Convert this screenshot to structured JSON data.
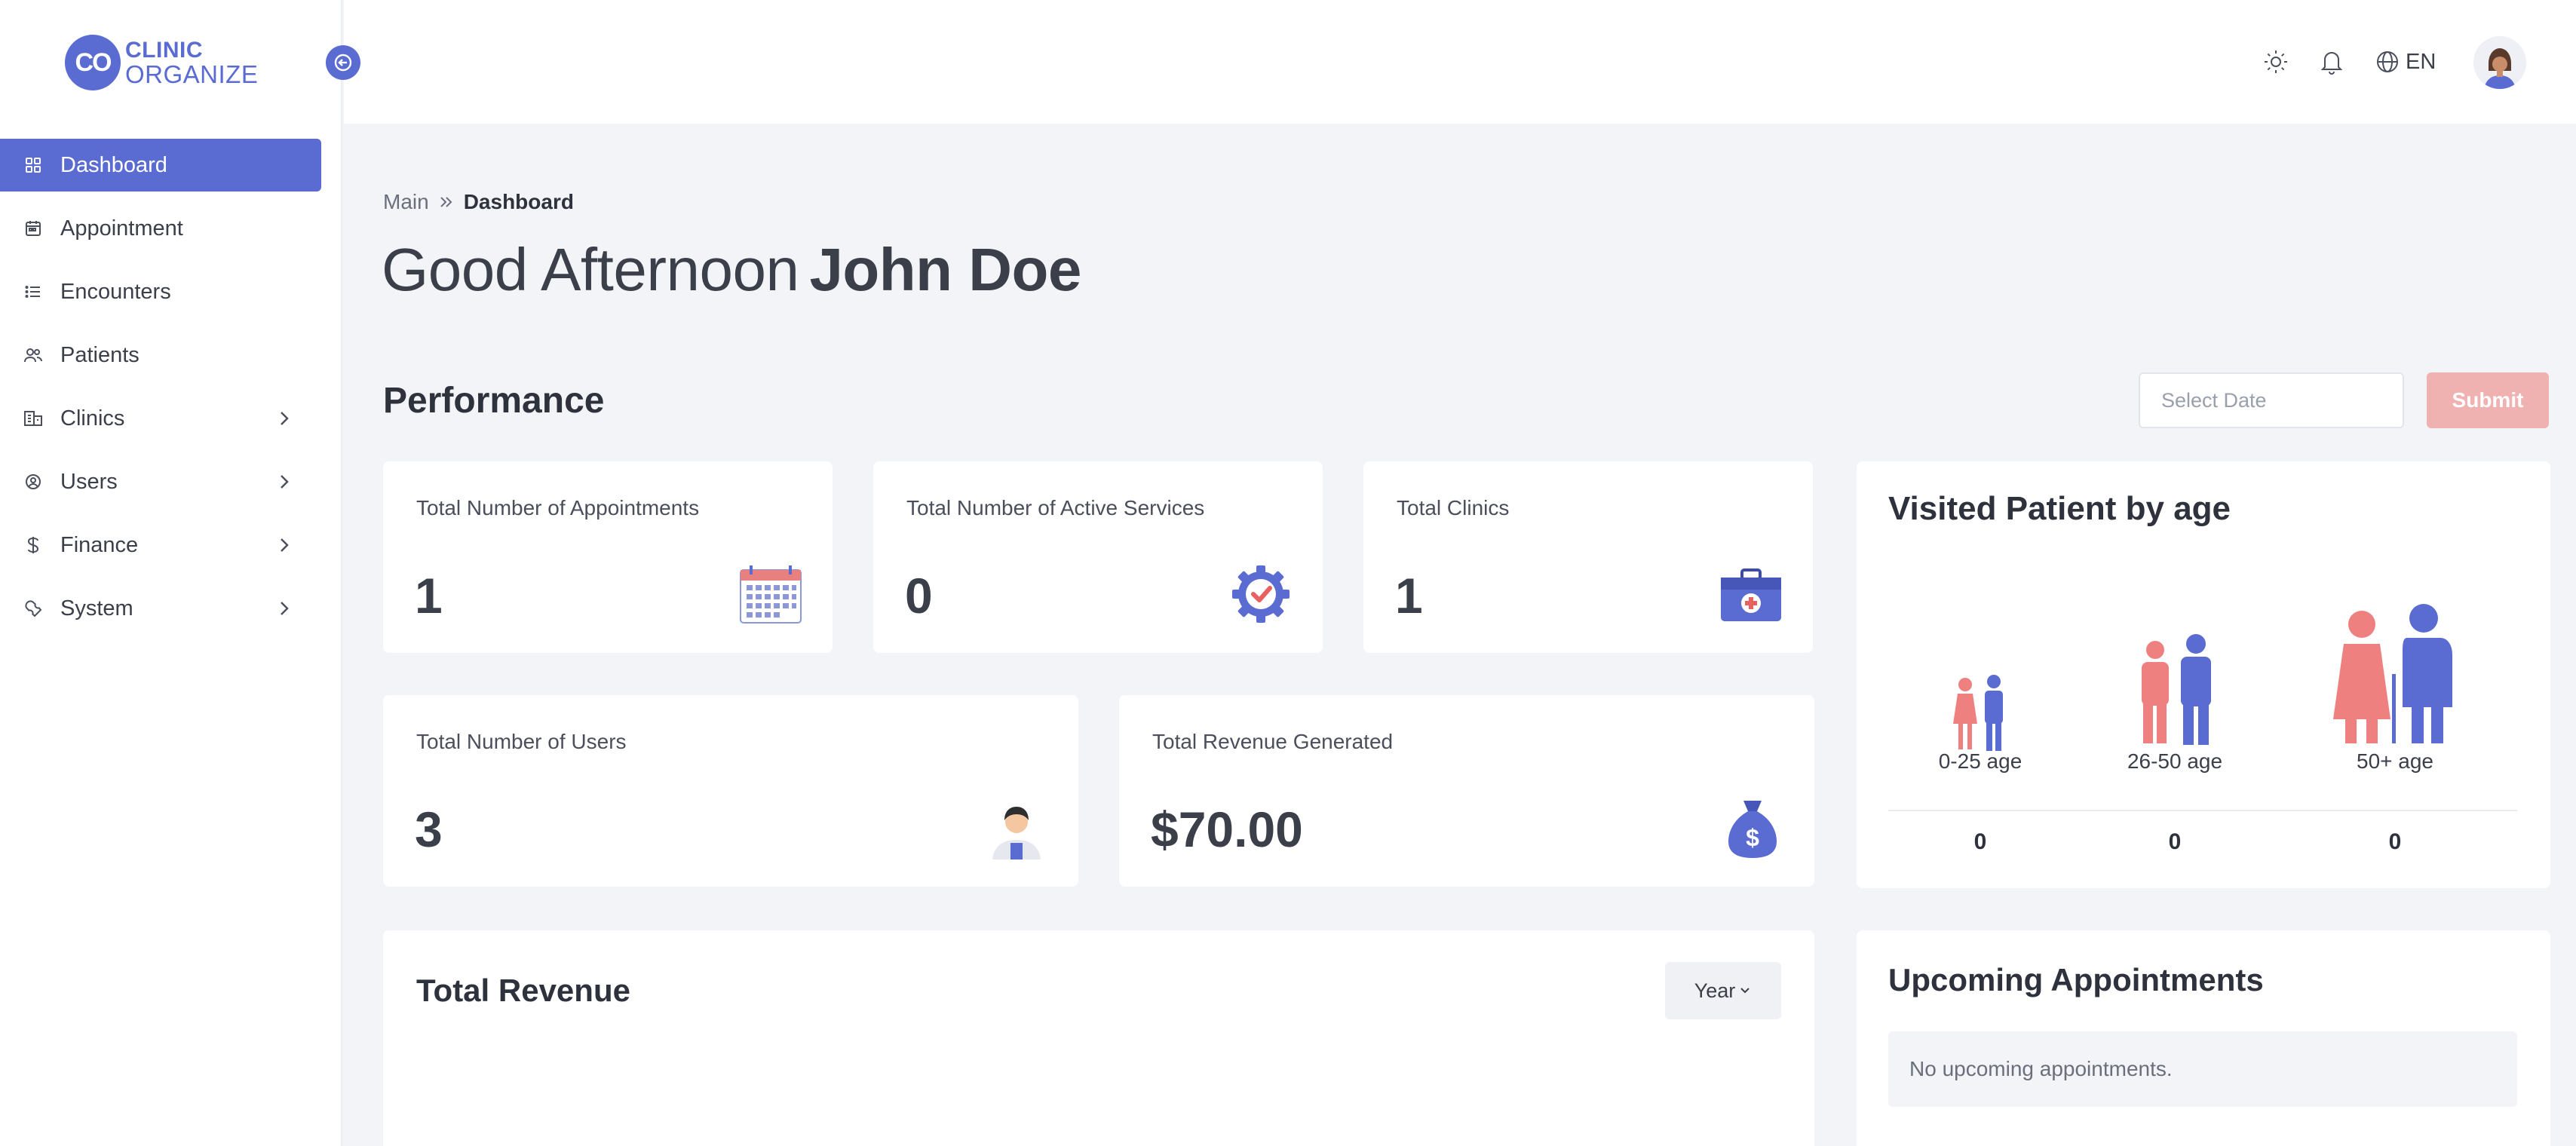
{
  "brand": {
    "mark": "CO",
    "line1": "CLINIC",
    "line2": "ORGANIZE",
    "color": "#5a6bd1"
  },
  "sidebar": {
    "items": [
      {
        "label": "Dashboard",
        "icon": "grid-icon",
        "active": true,
        "expandable": false
      },
      {
        "label": "Appointment",
        "icon": "calendar-icon",
        "active": false,
        "expandable": false
      },
      {
        "label": "Encounters",
        "icon": "list-icon",
        "active": false,
        "expandable": false
      },
      {
        "label": "Patients",
        "icon": "users-icon",
        "active": false,
        "expandable": false
      },
      {
        "label": "Clinics",
        "icon": "building-icon",
        "active": false,
        "expandable": true
      },
      {
        "label": "Users",
        "icon": "user-cog-icon",
        "active": false,
        "expandable": true
      },
      {
        "label": "Finance",
        "icon": "dollar-icon",
        "active": false,
        "expandable": true
      },
      {
        "label": "System",
        "icon": "wrench-icon",
        "active": false,
        "expandable": true
      }
    ]
  },
  "topbar": {
    "language": "EN",
    "icons": [
      "sun-icon",
      "bell-icon",
      "globe-icon",
      "avatar"
    ]
  },
  "breadcrumb": {
    "root": "Main",
    "current": "Dashboard"
  },
  "greeting": {
    "prefix": "Good Afternoon",
    "name": "John Doe"
  },
  "performance": {
    "title": "Performance",
    "date_placeholder": "Select Date",
    "submit_label": "Submit",
    "submit_color": "#f0b1b1"
  },
  "stats": {
    "appointments": {
      "label": "Total Number of Appointments",
      "value": "1",
      "icon": "calendar-icon"
    },
    "services": {
      "label": "Total Number of Active Services",
      "value": "0",
      "icon": "gear-check-icon"
    },
    "clinics": {
      "label": "Total Clinics",
      "value": "1",
      "icon": "medical-kit-icon"
    },
    "users": {
      "label": "Total Number of Users",
      "value": "3",
      "icon": "doctor-icon"
    },
    "revenue": {
      "label": "Total Revenue Generated",
      "value": "$70.00",
      "icon": "money-bag-icon"
    }
  },
  "visited_by_age": {
    "title": "Visited Patient by age",
    "groups": [
      {
        "label": "0-25 age",
        "value": "0"
      },
      {
        "label": "26-50 age",
        "value": "0"
      },
      {
        "label": "50+ age",
        "value": "0"
      }
    ]
  },
  "total_revenue": {
    "title": "Total Revenue",
    "period_label": "Year"
  },
  "upcoming": {
    "title": "Upcoming Appointments",
    "empty_text": "No upcoming appointments."
  }
}
